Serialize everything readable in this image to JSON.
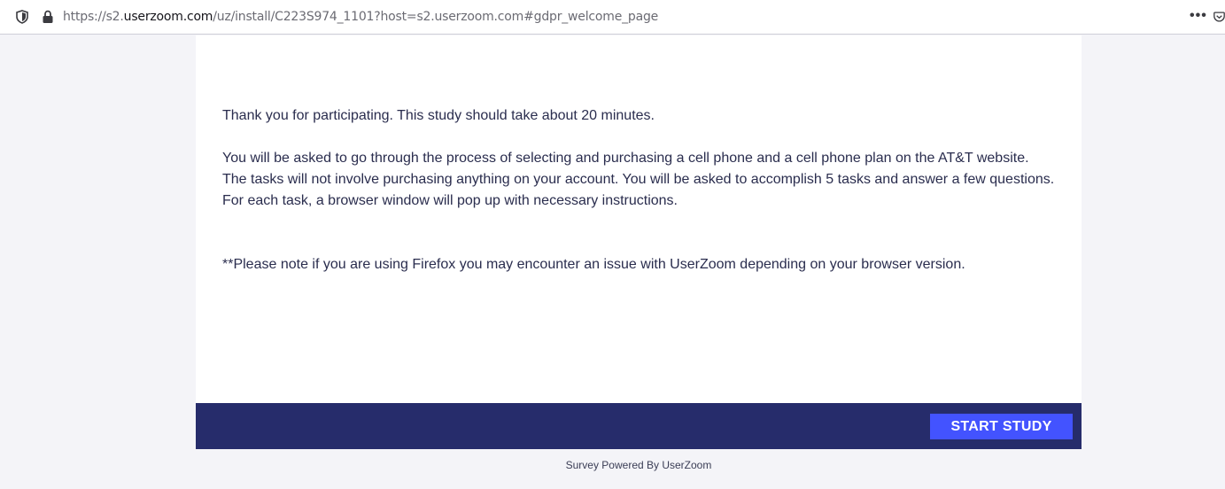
{
  "browser": {
    "url_prefix": "https://s2.",
    "url_host": "userzoom.com",
    "url_rest": "/uz/install/C223S974_1101?host=s2.userzoom.com#gdpr_welcome_page",
    "more_label": "•••"
  },
  "content": {
    "intro": "Thank you for participating. This study should take about 20 minutes.",
    "instructions": [
      "You will be asked to go through the process of selecting and purchasing a cell phone and a cell phone plan on the AT&T website.",
      "The tasks will not involve purchasing anything on your account. You will be asked to accomplish 5 tasks and answer a few questions.",
      "For each task, a browser window will pop up with necessary instructions."
    ],
    "note": "**Please note if you are using Firefox you may encounter an issue with UserZoom depending on your browser version."
  },
  "footer": {
    "start_button": "START STUDY",
    "powered_by": "Survey Powered By UserZoom"
  },
  "colors": {
    "footer_bar": "#262c6b",
    "button": "#4353ff",
    "text": "#2a2d4e"
  }
}
